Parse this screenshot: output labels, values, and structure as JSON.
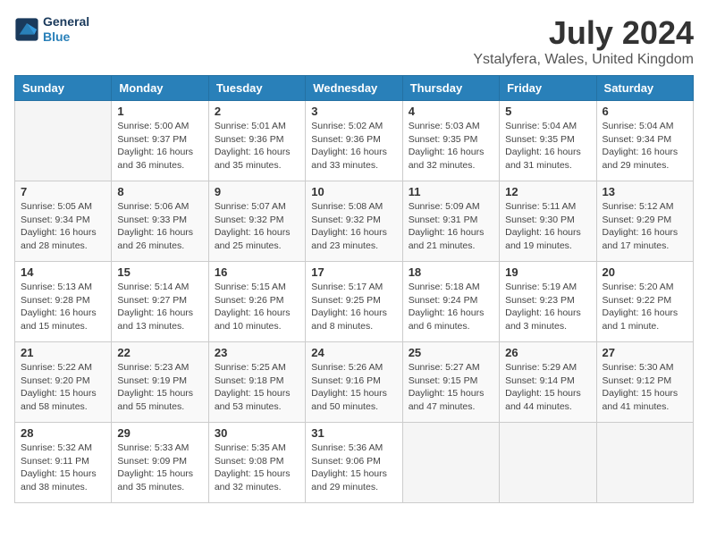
{
  "header": {
    "logo_line1": "General",
    "logo_line2": "Blue",
    "month": "July 2024",
    "location": "Ystalyfera, Wales, United Kingdom"
  },
  "weekdays": [
    "Sunday",
    "Monday",
    "Tuesday",
    "Wednesday",
    "Thursday",
    "Friday",
    "Saturday"
  ],
  "weeks": [
    [
      {
        "day": "",
        "info": ""
      },
      {
        "day": "1",
        "info": "Sunrise: 5:00 AM\nSunset: 9:37 PM\nDaylight: 16 hours\nand 36 minutes."
      },
      {
        "day": "2",
        "info": "Sunrise: 5:01 AM\nSunset: 9:36 PM\nDaylight: 16 hours\nand 35 minutes."
      },
      {
        "day": "3",
        "info": "Sunrise: 5:02 AM\nSunset: 9:36 PM\nDaylight: 16 hours\nand 33 minutes."
      },
      {
        "day": "4",
        "info": "Sunrise: 5:03 AM\nSunset: 9:35 PM\nDaylight: 16 hours\nand 32 minutes."
      },
      {
        "day": "5",
        "info": "Sunrise: 5:04 AM\nSunset: 9:35 PM\nDaylight: 16 hours\nand 31 minutes."
      },
      {
        "day": "6",
        "info": "Sunrise: 5:04 AM\nSunset: 9:34 PM\nDaylight: 16 hours\nand 29 minutes."
      }
    ],
    [
      {
        "day": "7",
        "info": "Sunrise: 5:05 AM\nSunset: 9:34 PM\nDaylight: 16 hours\nand 28 minutes."
      },
      {
        "day": "8",
        "info": "Sunrise: 5:06 AM\nSunset: 9:33 PM\nDaylight: 16 hours\nand 26 minutes."
      },
      {
        "day": "9",
        "info": "Sunrise: 5:07 AM\nSunset: 9:32 PM\nDaylight: 16 hours\nand 25 minutes."
      },
      {
        "day": "10",
        "info": "Sunrise: 5:08 AM\nSunset: 9:32 PM\nDaylight: 16 hours\nand 23 minutes."
      },
      {
        "day": "11",
        "info": "Sunrise: 5:09 AM\nSunset: 9:31 PM\nDaylight: 16 hours\nand 21 minutes."
      },
      {
        "day": "12",
        "info": "Sunrise: 5:11 AM\nSunset: 9:30 PM\nDaylight: 16 hours\nand 19 minutes."
      },
      {
        "day": "13",
        "info": "Sunrise: 5:12 AM\nSunset: 9:29 PM\nDaylight: 16 hours\nand 17 minutes."
      }
    ],
    [
      {
        "day": "14",
        "info": "Sunrise: 5:13 AM\nSunset: 9:28 PM\nDaylight: 16 hours\nand 15 minutes."
      },
      {
        "day": "15",
        "info": "Sunrise: 5:14 AM\nSunset: 9:27 PM\nDaylight: 16 hours\nand 13 minutes."
      },
      {
        "day": "16",
        "info": "Sunrise: 5:15 AM\nSunset: 9:26 PM\nDaylight: 16 hours\nand 10 minutes."
      },
      {
        "day": "17",
        "info": "Sunrise: 5:17 AM\nSunset: 9:25 PM\nDaylight: 16 hours\nand 8 minutes."
      },
      {
        "day": "18",
        "info": "Sunrise: 5:18 AM\nSunset: 9:24 PM\nDaylight: 16 hours\nand 6 minutes."
      },
      {
        "day": "19",
        "info": "Sunrise: 5:19 AM\nSunset: 9:23 PM\nDaylight: 16 hours\nand 3 minutes."
      },
      {
        "day": "20",
        "info": "Sunrise: 5:20 AM\nSunset: 9:22 PM\nDaylight: 16 hours\nand 1 minute."
      }
    ],
    [
      {
        "day": "21",
        "info": "Sunrise: 5:22 AM\nSunset: 9:20 PM\nDaylight: 15 hours\nand 58 minutes."
      },
      {
        "day": "22",
        "info": "Sunrise: 5:23 AM\nSunset: 9:19 PM\nDaylight: 15 hours\nand 55 minutes."
      },
      {
        "day": "23",
        "info": "Sunrise: 5:25 AM\nSunset: 9:18 PM\nDaylight: 15 hours\nand 53 minutes."
      },
      {
        "day": "24",
        "info": "Sunrise: 5:26 AM\nSunset: 9:16 PM\nDaylight: 15 hours\nand 50 minutes."
      },
      {
        "day": "25",
        "info": "Sunrise: 5:27 AM\nSunset: 9:15 PM\nDaylight: 15 hours\nand 47 minutes."
      },
      {
        "day": "26",
        "info": "Sunrise: 5:29 AM\nSunset: 9:14 PM\nDaylight: 15 hours\nand 44 minutes."
      },
      {
        "day": "27",
        "info": "Sunrise: 5:30 AM\nSunset: 9:12 PM\nDaylight: 15 hours\nand 41 minutes."
      }
    ],
    [
      {
        "day": "28",
        "info": "Sunrise: 5:32 AM\nSunset: 9:11 PM\nDaylight: 15 hours\nand 38 minutes."
      },
      {
        "day": "29",
        "info": "Sunrise: 5:33 AM\nSunset: 9:09 PM\nDaylight: 15 hours\nand 35 minutes."
      },
      {
        "day": "30",
        "info": "Sunrise: 5:35 AM\nSunset: 9:08 PM\nDaylight: 15 hours\nand 32 minutes."
      },
      {
        "day": "31",
        "info": "Sunrise: 5:36 AM\nSunset: 9:06 PM\nDaylight: 15 hours\nand 29 minutes."
      },
      {
        "day": "",
        "info": ""
      },
      {
        "day": "",
        "info": ""
      },
      {
        "day": "",
        "info": ""
      }
    ]
  ]
}
